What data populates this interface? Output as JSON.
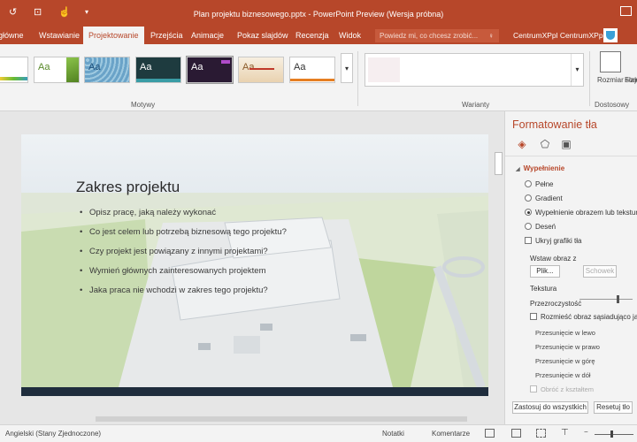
{
  "window": {
    "title": "Plan projektu biznesowego.pptx - PowerPoint Preview (Wersja próbna)"
  },
  "tabs": [
    {
      "label": "główne"
    },
    {
      "label": "Wstawianie"
    },
    {
      "label": "Projektowanie"
    },
    {
      "label": "Przejścia"
    },
    {
      "label": "Animacje"
    },
    {
      "label": "Pokaz slajdów"
    },
    {
      "label": "Recenzja"
    },
    {
      "label": "Widok"
    }
  ],
  "tell_me": {
    "placeholder": "Powiedz mi, co chcesz zrobić..."
  },
  "account": {
    "name": "CentrumXPpl CentrumXPpl"
  },
  "ribbon": {
    "themes_group": "Motywy",
    "variants_group": "Warianty",
    "customize_group": "Dostosowy",
    "slide_size_label": "Rozmiar slajdu",
    "format_label": "Form",
    "theme_sample": "Aa"
  },
  "slide": {
    "title": "Zakres projektu",
    "bullets": [
      "Opisz pracę, jaką należy wykonać",
      "Co jest celem lub potrzebą biznesową tego projektu?",
      "Czy projekt jest powiązany z innymi projektami?",
      "Wymień głównych zainteresowanych projektem",
      "Jaka praca nie wchodzi w zakres tego projektu?"
    ]
  },
  "format_pane": {
    "title": "Formatowanie tła",
    "section": "Wypełnienie",
    "fill_options": [
      {
        "label": "Pełne",
        "selected": false
      },
      {
        "label": "Gradient",
        "selected": false
      },
      {
        "label": "Wypełnienie obrazem lub teksturą",
        "selected": true
      },
      {
        "label": "Deseń",
        "selected": false
      }
    ],
    "hide_graphics": "Ukryj grafiki tła",
    "insert_image_from": "Wstaw obraz z",
    "file_button": "Plik...",
    "clipboard_button": "Schowek",
    "texture_label": "Tekstura",
    "transparency_label": "Przezroczystość",
    "tile_label": "Rozmieść obraz sąsiadująco jako te",
    "offset_left": "Przesunięcie w lewo",
    "offset_right": "Przesunięcie w prawo",
    "offset_top": "Przesunięcie w górę",
    "offset_bottom": "Przesunięcie w dół",
    "rotate_with_shape": "Obróć z kształtem",
    "apply_all_button": "Zastosuj do wszystkich",
    "reset_button": "Resetuj tło"
  },
  "status_bar": {
    "language": "Angielski (Stany Zjednoczone)",
    "notes": "Notatki",
    "comments": "Komentarze"
  },
  "colors": {
    "accent": "#b7472a"
  }
}
